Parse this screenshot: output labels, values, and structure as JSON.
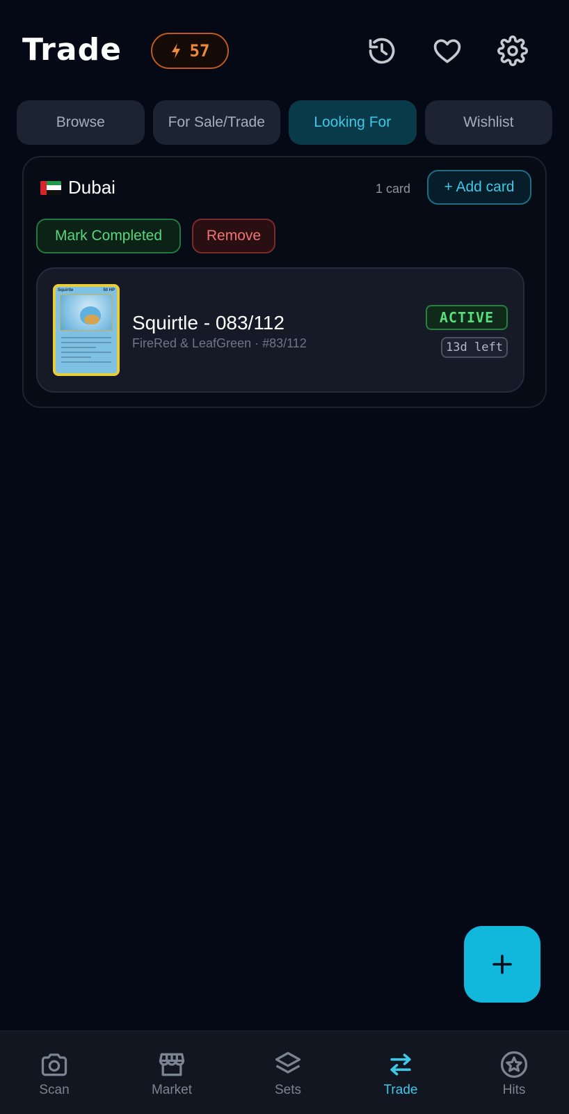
{
  "header": {
    "title": "Trade",
    "points": "57",
    "points_icon": "lightning-icon",
    "icons": [
      "history-icon",
      "heart-icon",
      "gear-icon"
    ]
  },
  "tabs": [
    {
      "label": "Browse",
      "active": false
    },
    {
      "label": "For Sale/Trade",
      "active": false
    },
    {
      "label": "Looking For",
      "active": true
    },
    {
      "label": "Wishlist",
      "active": false
    }
  ],
  "group": {
    "location": "Dubai",
    "flag": "uae-flag",
    "card_count": "1 card",
    "add_card_label": "+ Add card",
    "mark_completed_label": "Mark Completed",
    "remove_label": "Remove",
    "items": [
      {
        "title": "Squirtle - 083/112",
        "subtitle": "FireRed & LeafGreen · #83/112",
        "status": "ACTIVE",
        "time_left": "13d left",
        "thumb_name": "Squirtle",
        "thumb_hp": "50 HP"
      }
    ]
  },
  "fab": {
    "icon": "plus-icon"
  },
  "bottom_nav": [
    {
      "label": "Scan",
      "icon": "camera-icon",
      "active": false
    },
    {
      "label": "Market",
      "icon": "store-icon",
      "active": false
    },
    {
      "label": "Sets",
      "icon": "layers-icon",
      "active": false
    },
    {
      "label": "Trade",
      "icon": "swap-icon",
      "active": true
    },
    {
      "label": "Hits",
      "icon": "star-circle-icon",
      "active": false
    }
  ],
  "colors": {
    "background": "#050915",
    "accent": "#3ec8e6",
    "points": "#f08a3a",
    "success": "#59dd7d",
    "danger": "#f07474",
    "fab": "#12b8dc"
  }
}
